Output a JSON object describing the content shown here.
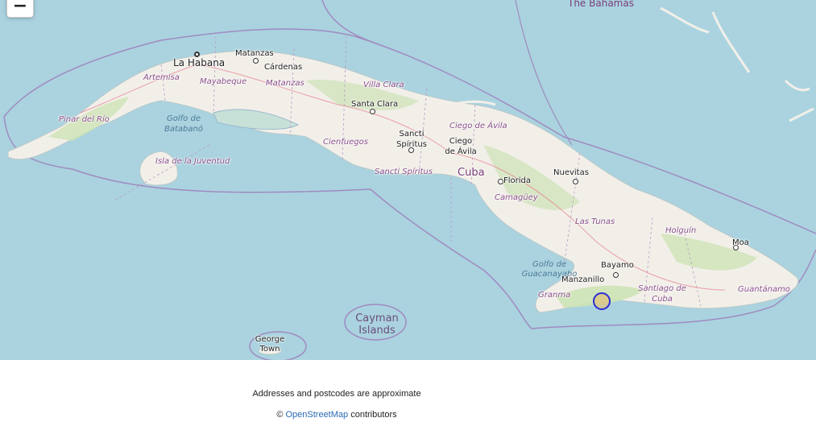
{
  "map": {
    "zoom_out_label": "−",
    "labels": {
      "bahamas": "The Bahamas",
      "la_habana": "La Habana",
      "matanzas_city": "Matanzas",
      "cardenas": "Cárdenas",
      "artemisa": "Artemisa",
      "mayabeque": "Mayabeque",
      "matanzas_prov": "Matanzas",
      "villa_clara": "Villa Clara",
      "santa_clara": "Santa Clara",
      "pinar": "Pinar del Río",
      "golfo_batabano": "Golfo de Batabanó",
      "isla_juventud": "Isla de la Juventud",
      "cienfuegos": "Cienfuegos",
      "sancti_spiritus_city": "Sancti Spíritus",
      "sancti_spiritus_prov": "Sancti Spíritus",
      "ciego_prov": "Ciego de Ávila",
      "ciego_city": "Ciego de Ávila",
      "cuba": "Cuba",
      "florida": "Florida",
      "nuevitas": "Nuevitas",
      "camaguey": "Camagüey",
      "las_tunas": "Las Tunas",
      "holguin": "Holguín",
      "moa": "Moa",
      "bayamo": "Bayamo",
      "golfo_guacanayabo": "Golfo de Guacanayabo",
      "manzanillo": "Manzanillo",
      "granma": "Granma",
      "santiago": "Santiago de Cuba",
      "guantanamo": "Guantánamo",
      "cayman": "Cayman Islands",
      "george_town": "George Town"
    }
  },
  "footer": {
    "note": "Addresses and postcodes are approximate",
    "copyright_symbol": "©",
    "osm_link": "OpenStreetMap",
    "contributors": "contributors"
  },
  "colors": {
    "water": "#aad3df",
    "land": "#f2efe9",
    "vegetation": "#cde3b5",
    "boundary": "#a08bc0",
    "marker": "#2b2bd4"
  }
}
